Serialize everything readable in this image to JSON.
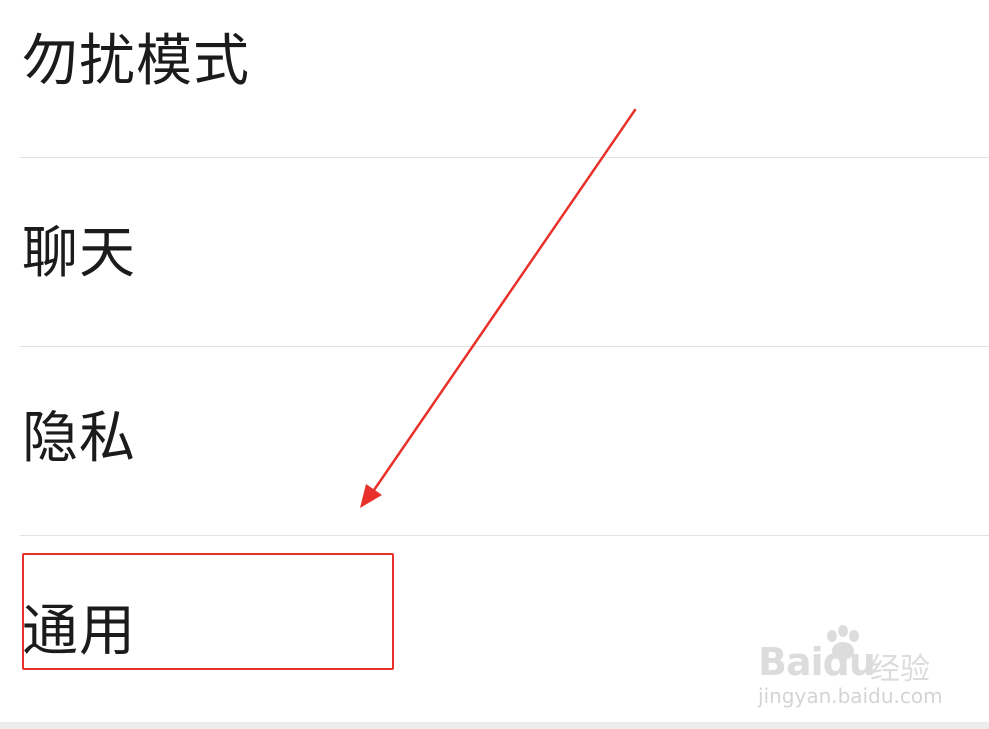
{
  "settings": {
    "items": [
      {
        "label": "勿扰模式"
      },
      {
        "label": "聊天"
      },
      {
        "label": "隐私"
      },
      {
        "label": "通用"
      }
    ]
  },
  "annotation": {
    "highlight_color": "#e8312b",
    "arrow_color": "#e8312b",
    "highlighted_item": "通用"
  },
  "watermark": {
    "brand": "Baidu",
    "suffix": "经验",
    "url": "jingyan.baidu.com"
  },
  "colors": {
    "background": "#ffffff",
    "text": "#1b1b1b",
    "divider": "#e2e2e2"
  }
}
